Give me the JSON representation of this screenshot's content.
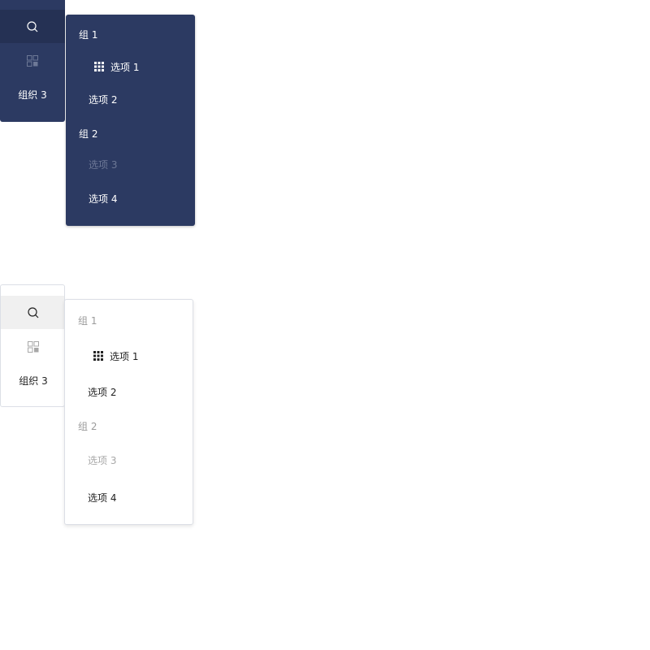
{
  "dark": {
    "rail": {
      "search_icon": "search-icon",
      "app_icon": "app-grid-icon",
      "org_label": "组织 3"
    },
    "popup": {
      "group1_title": "组 1",
      "option1_label": "选项 1",
      "option1_icon": "grid-icon",
      "option2_label": "选项 2",
      "group2_title": "组 2",
      "option3_label": "选项 3",
      "option4_label": "选项 4"
    }
  },
  "light": {
    "rail": {
      "search_icon": "search-icon",
      "app_icon": "app-grid-icon",
      "org_label": "组织 3"
    },
    "popup": {
      "group1_title": "组 1",
      "option1_label": "选项 1",
      "option1_icon": "grid-icon",
      "option2_label": "选项 2",
      "group2_title": "组 2",
      "option3_label": "选项 3",
      "option4_label": "选项 4"
    }
  },
  "colors": {
    "dark_bg": "#2c3a62",
    "dark_active": "#253154",
    "light_active": "#f0f0f0",
    "border": "#dcdfe6"
  }
}
